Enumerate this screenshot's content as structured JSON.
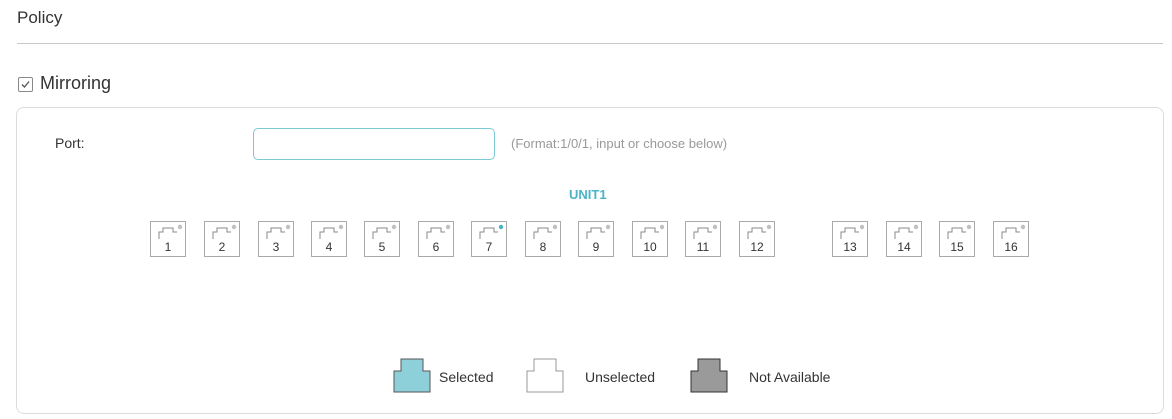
{
  "section": {
    "title": "Policy"
  },
  "mirroring": {
    "label": "Mirroring",
    "checked": true
  },
  "port": {
    "label": "Port:",
    "value": "",
    "placeholder": "",
    "hint": "(Format:1/0/1, input or choose below)"
  },
  "unit": {
    "label": "UNIT1"
  },
  "ports": [
    {
      "num": "1",
      "indicator": "grey"
    },
    {
      "num": "2",
      "indicator": "grey"
    },
    {
      "num": "3",
      "indicator": "grey"
    },
    {
      "num": "4",
      "indicator": "grey"
    },
    {
      "num": "5",
      "indicator": "grey"
    },
    {
      "num": "6",
      "indicator": "grey"
    },
    {
      "num": "7",
      "indicator": "teal"
    },
    {
      "num": "8",
      "indicator": "grey"
    },
    {
      "num": "9",
      "indicator": "grey"
    },
    {
      "num": "10",
      "indicator": "grey"
    },
    {
      "num": "11",
      "indicator": "grey"
    },
    {
      "num": "12",
      "indicator": "grey"
    },
    {
      "num": "13",
      "indicator": "grey"
    },
    {
      "num": "14",
      "indicator": "grey"
    },
    {
      "num": "15",
      "indicator": "grey"
    },
    {
      "num": "16",
      "indicator": "grey"
    }
  ],
  "legend": {
    "selected": "Selected",
    "unselected": "Unselected",
    "not_available": "Not Available"
  },
  "colors": {
    "accent": "#4ab4c4",
    "selected_fill": "#8ed0da",
    "not_available_fill": "#9a9a9a",
    "indicator_grey": "#c0c0c0",
    "indicator_teal": "#4ab4c4"
  }
}
